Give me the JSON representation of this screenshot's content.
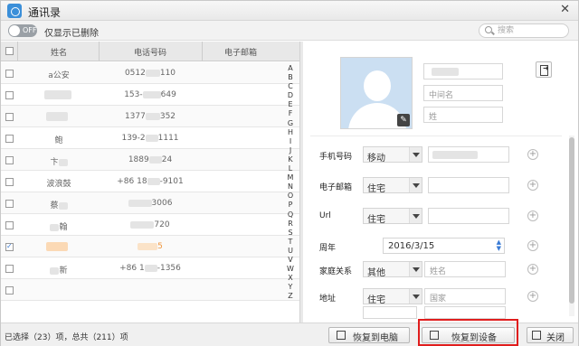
{
  "window": {
    "title": "通讯录",
    "close_glyph": "✕"
  },
  "toolbar": {
    "toggle_state": "OFF",
    "toggle_label": "仅显示已删除",
    "search_placeholder": "搜索"
  },
  "table": {
    "headers": {
      "name": "姓名",
      "phone": "电话号码",
      "email": "电子邮箱"
    },
    "rows": [
      {
        "name": "a公安",
        "phone": "0512",
        "phone_end": "110",
        "checked": false
      },
      {
        "name": "",
        "phone": "153-",
        "phone_end": "649",
        "checked": false
      },
      {
        "name": "",
        "phone": "1377",
        "phone_end": "352",
        "checked": false
      },
      {
        "name": "鲍",
        "phone": "139-2",
        "phone_end": "1111",
        "checked": false
      },
      {
        "name": "卞",
        "phone": "1889",
        "phone_end": "24",
        "checked": false
      },
      {
        "name": "波浪鼓",
        "phone": "+86 18",
        "phone_end": "-9101",
        "checked": false
      },
      {
        "name": "蔡",
        "phone": "",
        "phone_end": "3006",
        "checked": false
      },
      {
        "name": "翰",
        "phone": "",
        "phone_end": "720",
        "checked": false
      },
      {
        "name": "",
        "phone": "",
        "phone_end": "5",
        "checked": true,
        "highlight": true
      },
      {
        "name": "新",
        "phone": "+86 1",
        "phone_end": "-1356",
        "checked": false
      }
    ],
    "alphabet": [
      "A",
      "B",
      "C",
      "D",
      "E",
      "F",
      "G",
      "H",
      "I",
      "J",
      "K",
      "L",
      "M",
      "N",
      "O",
      "P",
      "Q",
      "R",
      "S",
      "T",
      "U",
      "V",
      "W",
      "X",
      "Y",
      "Z"
    ]
  },
  "detail": {
    "middle_name_placeholder": "中间名",
    "last_name_placeholder": "姓",
    "form": {
      "phone": {
        "label": "手机号码",
        "type": "移动"
      },
      "email": {
        "label": "电子邮箱",
        "type": "住宅"
      },
      "url": {
        "label": "Url",
        "type": "住宅"
      },
      "anniversary": {
        "label": "周年",
        "value": "2016/3/15"
      },
      "family": {
        "label": "家庭关系",
        "type": "其他",
        "placeholder": "姓名"
      },
      "address": {
        "label": "地址",
        "type": "住宅",
        "placeholder": "国家"
      }
    }
  },
  "status": {
    "text": "已选择（23）项，总共（211）项",
    "buttons": {
      "restore_pc": "恢复到电脑",
      "restore_device": "恢复到设备",
      "close": "关闭"
    }
  },
  "colors": {
    "accent": "#3a7bd5",
    "highlight_box": "#e01d1d",
    "orange_name": "#f0953c"
  }
}
